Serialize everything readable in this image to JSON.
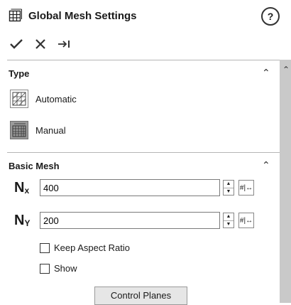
{
  "header": {
    "title": "Global Mesh Settings",
    "help_label": "?",
    "toolbar": {
      "ok_icon": "checkmark-icon",
      "cancel_icon": "close-icon",
      "pin_icon": "pushpin-icon"
    }
  },
  "type_section": {
    "title": "Type",
    "options": [
      {
        "label": "Automatic",
        "icon": "automatic-mesh-icon",
        "active": false
      },
      {
        "label": "Manual",
        "icon": "manual-mesh-icon",
        "active": true
      }
    ]
  },
  "basic_mesh": {
    "title": "Basic Mesh",
    "nx": {
      "label": "N",
      "sub": "x",
      "value": "400"
    },
    "ny": {
      "label": "N",
      "sub": "Y",
      "value": "200"
    },
    "keep_aspect_ratio": {
      "label": "Keep Aspect Ratio",
      "checked": false
    },
    "show": {
      "label": "Show",
      "checked": false
    },
    "control_planes_label": "Control Planes"
  }
}
